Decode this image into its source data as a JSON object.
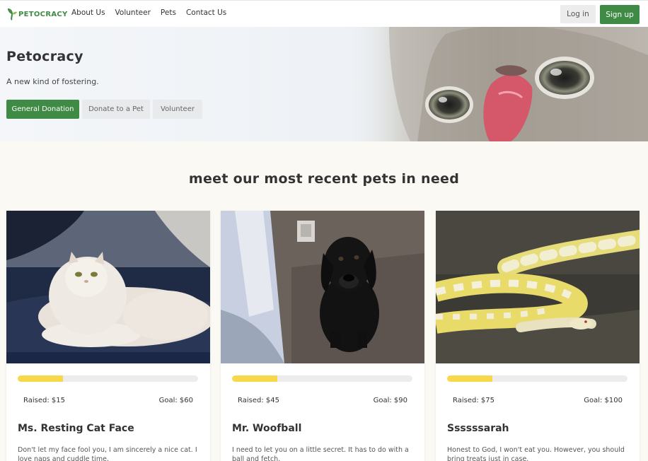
{
  "brand": {
    "name": "PETOCRACY",
    "color": "#3f8a44"
  },
  "nav": {
    "items": [
      "About Us",
      "Volunteer",
      "Pets",
      "Contact Us"
    ],
    "login": "Log in",
    "signup": "Sign up"
  },
  "hero": {
    "title": "Petocracy",
    "subtitle": "A new kind of fostering.",
    "buttons": {
      "donate": "General Donation",
      "donate_pet": "Donate to a Pet",
      "volunteer": "Volunteer"
    }
  },
  "section": {
    "title": "meet our most recent pets in need"
  },
  "pets": [
    {
      "name": "Ms. Resting Cat Face",
      "raised": "Raised: $15",
      "goal": "Goal: $60",
      "progress": 0.25,
      "desc": "Don't let my face fool you, I am sincerely a nice cat. I love naps and cuddle time."
    },
    {
      "name": "Mr. Woofball",
      "raised": "Raised: $45",
      "goal": "Goal: $90",
      "progress": 0.25,
      "desc": "I need to let you on a little secret. It has to do with a ball and fetch."
    },
    {
      "name": "Ssssssarah",
      "raised": "Raised: $75",
      "goal": "Goal: $100",
      "progress": 0.25,
      "desc": "Honest to God, I won't eat you. However, you should bring treats just in case."
    }
  ],
  "colors": {
    "accent": "#3f8a44",
    "progress": "#f7d84a",
    "background": "#fbf9f3"
  }
}
